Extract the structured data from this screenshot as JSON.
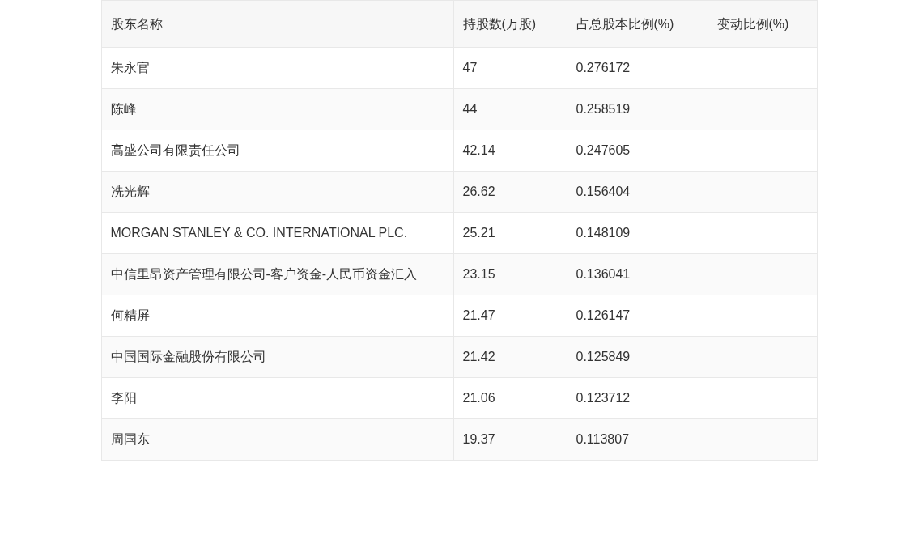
{
  "table": {
    "columns": [
      "股东名称",
      "持股数(万股)",
      "占总股本比例(%)",
      "变动比例(%)"
    ],
    "rows": [
      [
        "朱永官",
        "47",
        "0.276172",
        ""
      ],
      [
        "陈峰",
        "44",
        "0.258519",
        ""
      ],
      [
        "高盛公司有限责任公司",
        "42.14",
        "0.247605",
        ""
      ],
      [
        "冼光辉",
        "26.62",
        "0.156404",
        ""
      ],
      [
        "MORGAN STANLEY & CO. INTERNATIONAL PLC.",
        "25.21",
        "0.148109",
        ""
      ],
      [
        "中信里昂资产管理有限公司-客户资金-人民币资金汇入",
        "23.15",
        "0.136041",
        ""
      ],
      [
        "何精屏",
        "21.47",
        "0.126147",
        ""
      ],
      [
        "中国国际金融股份有限公司",
        "21.42",
        "0.125849",
        ""
      ],
      [
        "李阳",
        "21.06",
        "0.123712",
        ""
      ],
      [
        "周国东",
        "19.37",
        "0.113807",
        ""
      ]
    ]
  }
}
